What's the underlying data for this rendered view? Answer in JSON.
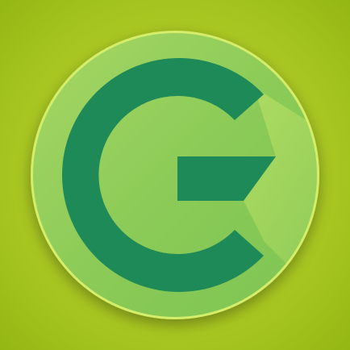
{
  "icon": {
    "name": "letter-g-logo-icon",
    "colors": {
      "background_center": "#c9e23a",
      "background_edge": "#94b612",
      "badge_light": "#a7d763",
      "badge_mid": "#8ccb58",
      "badge_dark": "#7dc452",
      "badge_rim": "#d4ed6a",
      "long_shadow": "#b9e064",
      "glyph": "#1e8a58"
    }
  }
}
